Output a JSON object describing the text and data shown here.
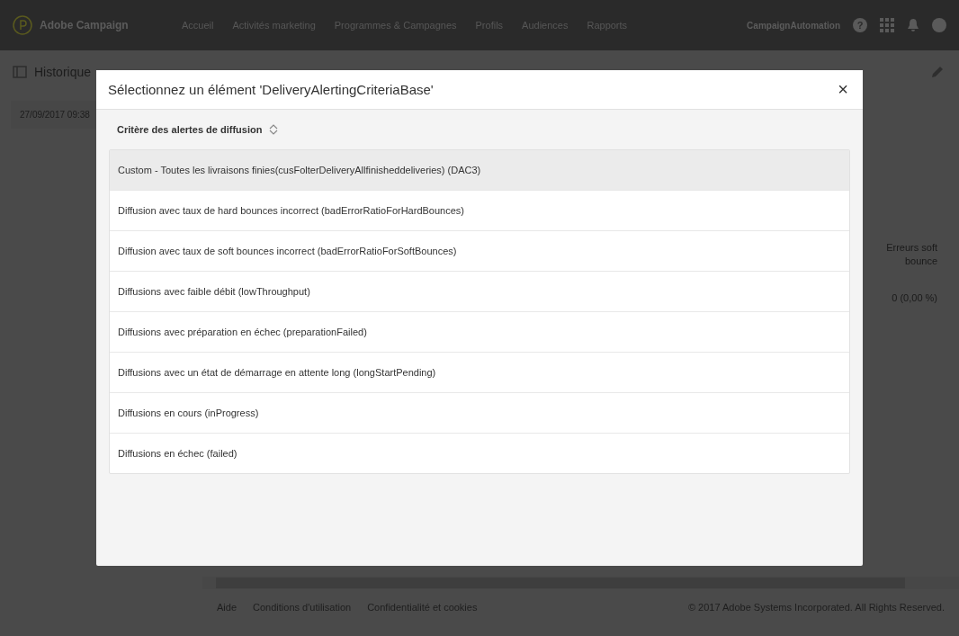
{
  "topbar": {
    "brand": "Adobe Campaign",
    "nav": [
      "Accueil",
      "Activités marketing",
      "Programmes & Campagnes",
      "Profils",
      "Audiences",
      "Rapports"
    ],
    "user": "CampaignAutomation",
    "help": "?"
  },
  "sidebar": {
    "title": "Historique",
    "date": "27/09/2017 09:38"
  },
  "table": {
    "column": "Erreurs soft bounce",
    "value": "0 (0,00 %)"
  },
  "dialog": {
    "title": "Sélectionnez un élément 'DeliveryAlertingCriteriaBase'",
    "close": "×",
    "section": "Critère des alertes de diffusion",
    "items": [
      {
        "label": "Custom - Toutes les livraisons finies(cusFolterDeliveryAllfinisheddeliveries) (DAC3)",
        "selected": true
      },
      {
        "label": "Diffusion avec taux de hard bounces incorrect (badErrorRatioForHardBounces)",
        "selected": false
      },
      {
        "label": "Diffusion avec taux de soft bounces incorrect (badErrorRatioForSoftBounces)",
        "selected": false
      },
      {
        "label": "Diffusions avec faible débit (lowThroughput)",
        "selected": false
      },
      {
        "label": "Diffusions avec préparation en échec (preparationFailed)",
        "selected": false
      },
      {
        "label": "Diffusions avec un état de démarrage en attente long (longStartPending)",
        "selected": false
      },
      {
        "label": "Diffusions en cours (inProgress)",
        "selected": false
      },
      {
        "label": "Diffusions en échec (failed)",
        "selected": false
      }
    ]
  },
  "footer": {
    "links": [
      "Aide",
      "Conditions d'utilisation",
      "Confidentialité et cookies"
    ],
    "copyright": "© 2017 Adobe Systems Incorporated. All Rights Reserved."
  }
}
